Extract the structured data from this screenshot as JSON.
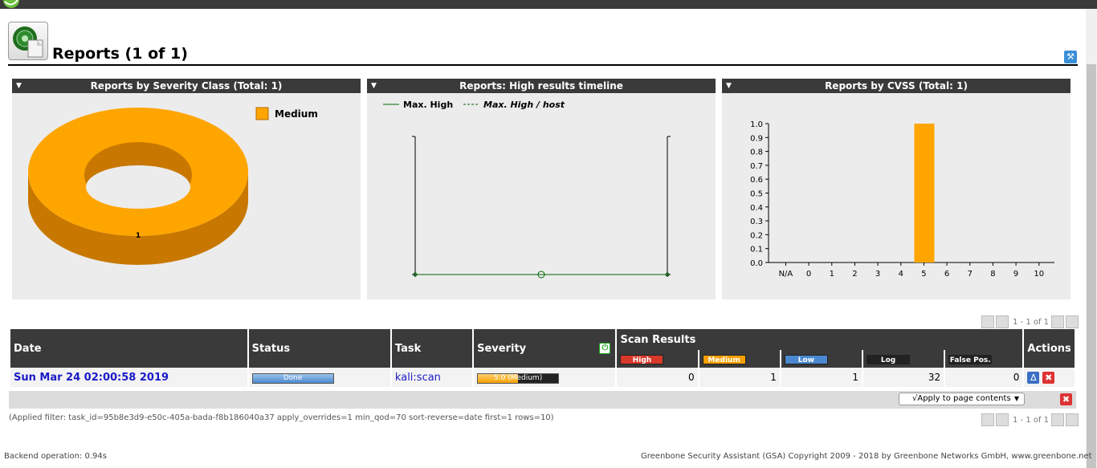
{
  "page": {
    "title": "Reports (1 of 1)"
  },
  "panels": {
    "severity": {
      "title": "Reports by Severity Class (Total: 1)",
      "legend": "Medium",
      "slice_label": "1"
    },
    "timeline": {
      "title": "Reports: High results timeline",
      "legend_max_high": "Max. High",
      "legend_max_high_host": "Max. High / host"
    },
    "cvss": {
      "title": "Reports by CVSS (Total: 1)"
    }
  },
  "chart_data": [
    {
      "type": "pie",
      "categories": [
        "Medium"
      ],
      "values": [
        1
      ],
      "colors": [
        "#ffa500"
      ],
      "title": "Reports by Severity Class (Total: 1)",
      "legend": "top-right"
    },
    {
      "type": "line",
      "series": [
        {
          "name": "Max. High",
          "style": "solid",
          "color": "#006400",
          "values": [
            0,
            0,
            0
          ]
        },
        {
          "name": "Max. High / host",
          "style": "dashed",
          "color": "#006400",
          "values": []
        }
      ],
      "title": "Reports: High results timeline",
      "legend": "top-left"
    },
    {
      "type": "bar",
      "categories": [
        "N/A",
        "0",
        "1",
        "2",
        "3",
        "4",
        "5",
        "6",
        "7",
        "8",
        "9",
        "10"
      ],
      "values": [
        0,
        0,
        0,
        0,
        0,
        0,
        1,
        0,
        0,
        0,
        0,
        0
      ],
      "y_ticks": [
        "0.0",
        "0.1",
        "0.2",
        "0.3",
        "0.4",
        "0.5",
        "0.6",
        "0.7",
        "0.8",
        "0.9",
        "1.0"
      ],
      "ylim": [
        0,
        1
      ],
      "bar_color": "#ffa500",
      "title": "Reports by CVSS (Total: 1)"
    }
  ],
  "pager": {
    "text": "1 - 1 of 1"
  },
  "table": {
    "headers": {
      "date": "Date",
      "status": "Status",
      "task": "Task",
      "severity": "Severity",
      "scan_results": "Scan Results",
      "actions": "Actions"
    },
    "result_columns": [
      "High",
      "Medium",
      "Low",
      "Log",
      "False Pos."
    ],
    "result_colors": [
      "#d9392a",
      "#f5a000",
      "#4a89cf",
      "#222222",
      "#222222"
    ],
    "rows": [
      {
        "date": "Sun Mar 24 02:00:58 2019",
        "status": "Done",
        "task": "kali:scan",
        "severity": "5.0 (Medium)",
        "severity_fraction": 0.5,
        "high": "0",
        "medium": "1",
        "low": "1",
        "log": "32",
        "false_pos": "0"
      }
    ]
  },
  "bulk": {
    "apply_label": "√Apply to page contents"
  },
  "filter_text": "(Applied filter: task_id=95b8e3d9-e50c-405a-bada-f8b186040a37 apply_overrides=1 min_qod=70 sort-reverse=date first=1 rows=10)",
  "footer": {
    "backend": "Backend operation: 0.94s",
    "copyright": "Greenbone Security Assistant (GSA) Copyright 2009 - 2018 by Greenbone Networks GmbH, www.greenbone.net"
  }
}
